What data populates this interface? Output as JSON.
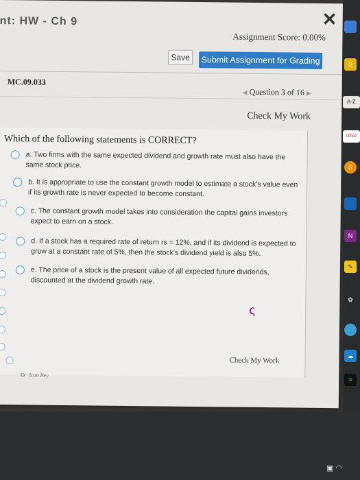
{
  "header": {
    "title_fragment": "nt: HW - Ch 9",
    "close_icon": "close-icon",
    "assignment_score": "Assignment Score: 0.00%",
    "save_label": "Save",
    "submit_label": "Submit Assignment for Grading"
  },
  "question_bar": {
    "code": "MC.09.033",
    "nav_prev_icon": "chevron-left-icon",
    "nav_label": "Question 3 of 16",
    "nav_next_icon": "chevron-right-icon",
    "check_label": "Check My Work"
  },
  "question": {
    "text": "Which of the following statements is CORRECT?",
    "options": [
      {
        "text": "a. Two firms with the same expected dividend and growth rate must also have the same stock price."
      },
      {
        "text": "b. It is appropriate to use the constant growth model to estimate a stock's value even if its growth rate is never expected to become constant."
      },
      {
        "text": "c. The constant growth model takes into consideration the capital gains investors expect to earn on a stock."
      },
      {
        "text": "d. If a stock has a required rate of return rs = 12%, and if its dividend is expected to grow at a constant rate of 5%, then the stock's dividend yield is also 5%."
      },
      {
        "text": "e. The price of a stock is the present value of all expected future dividends, discounted at the dividend growth rate."
      }
    ]
  },
  "footer": {
    "check_label": "Check My Work",
    "icon_key_label": "Icon Key"
  },
  "taskbar": {
    "items": [
      "A-Z",
      "Office"
    ]
  },
  "colors": {
    "submit_button": "#2f7bc7",
    "radio_border": "#47a0d0"
  }
}
